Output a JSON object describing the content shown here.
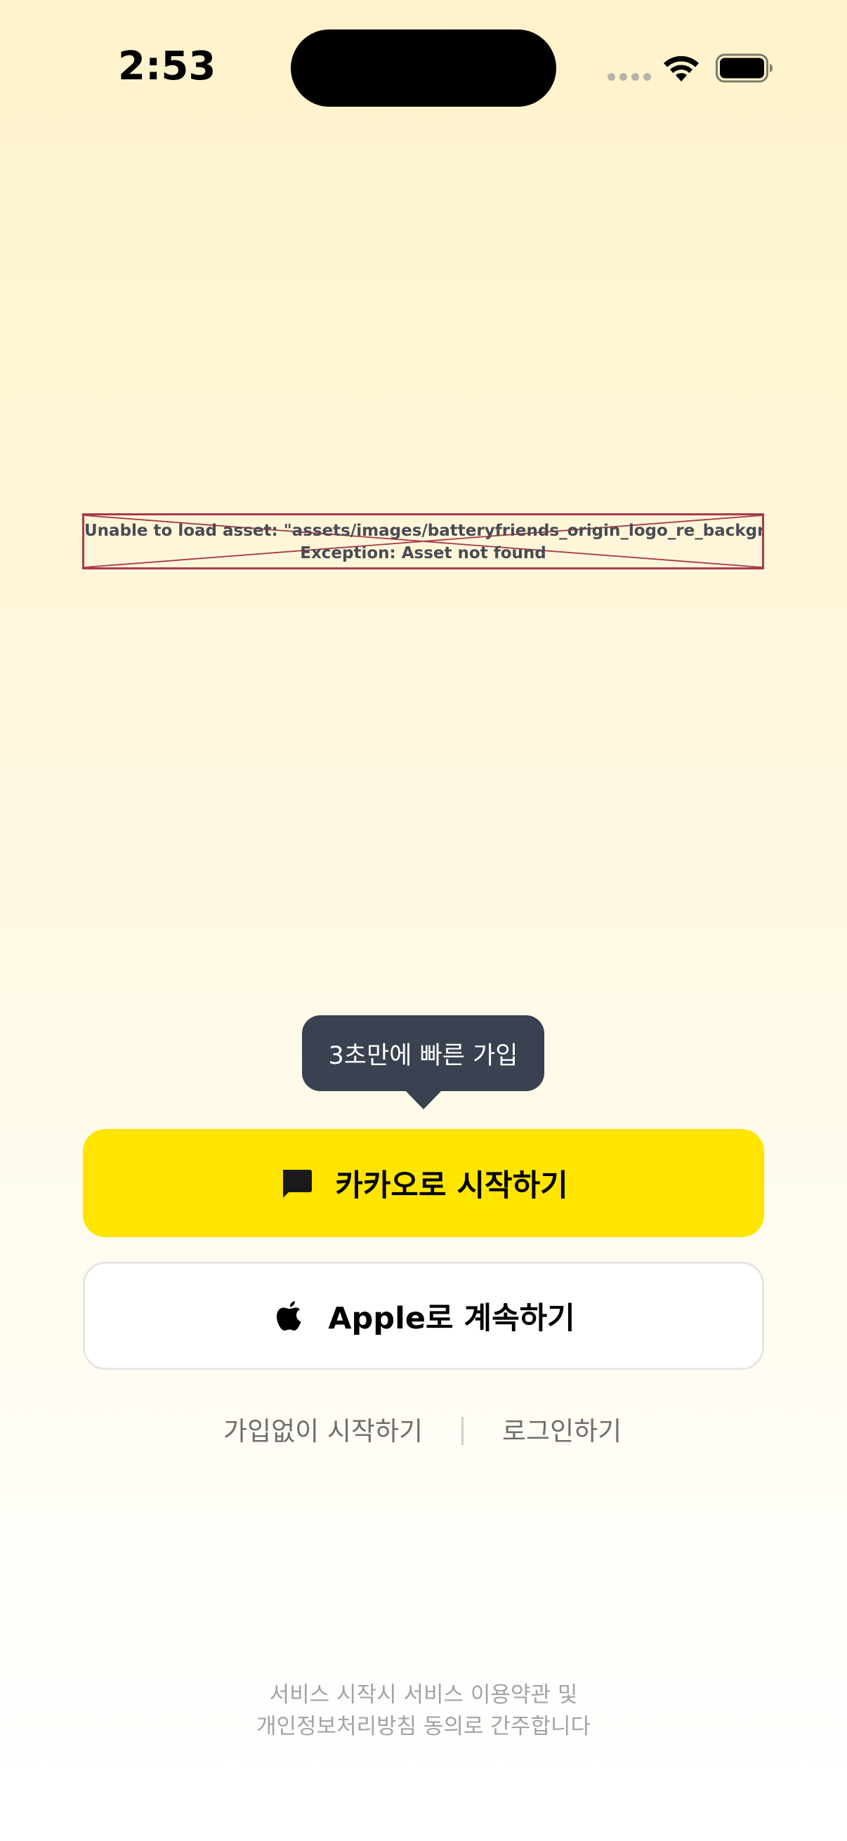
{
  "status_bar": {
    "time": "2:53"
  },
  "asset_error": {
    "line1": "Unable to load asset: \"assets/images/batteryfriends_origin_logo_re_background.png\".",
    "line2": "Exception: Asset not found",
    "border_color": "#a83a4a"
  },
  "tooltip": {
    "text": "3초만에 빠른 가입",
    "background": "#3a4150"
  },
  "kakao_button": {
    "label": "카카오로 시작하기",
    "icon": "chat-bubble-icon",
    "background": "#ffe500"
  },
  "apple_button": {
    "label": "Apple로 계속하기",
    "icon": "apple-logo-icon",
    "background": "#ffffff"
  },
  "links": {
    "guest_label": "가입없이 시작하기",
    "divider": "|",
    "login_label": "로그인하기"
  },
  "terms": {
    "line1": "서비스 시작시 서비스 이용약관 및",
    "line2": "개인정보처리방침 동의로 간주합니다"
  }
}
